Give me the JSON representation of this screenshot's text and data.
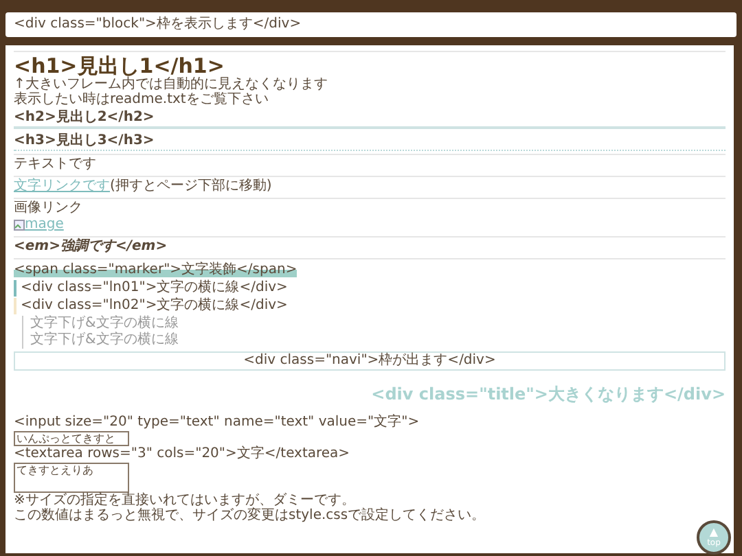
{
  "block": "<div class=\"block\">枠を表示します</div>",
  "h1": "<h1>見出し1</h1>",
  "h1_notes": [
    "↑大きいフレーム内では自動的に見えなくなります",
    "表示したい時はreadme.txtをご覧下さい"
  ],
  "h2": "<h2>見出し2</h2>",
  "h3": "<h3>見出し3</h3>",
  "text": "テキストです",
  "link": {
    "text": "文字リンクです",
    "note": "(押すとページ下部に移動)"
  },
  "image_link": {
    "label": "画像リンク",
    "alt": "mage"
  },
  "em": "<em>強調です</em>",
  "marker": "<span class=\"marker\">文字装飾</span>",
  "ln01": "<div class=\"ln01\">文字の横に線</div>",
  "ln02": "<div class=\"ln02\">文字の横に線</div>",
  "indent_lines": [
    "文字下げ&文字の横に線",
    "文字下げ&文字の横に線"
  ],
  "navi": "<div class=\"navi\">枠が出ます</div>",
  "title": "<div class=\"title\">大きくなります</div>",
  "input_label": "<input size=\"20\" type=\"text\" name=\"text\" value=\"文字\">",
  "input_value": "いんぷっとてきすと",
  "textarea_label": "<textarea rows=\"3\" cols=\"20\">文字</textarea>",
  "textarea_value": "てきすとえりあ",
  "notes": [
    "※サイズの指定を直接いれてはいますが、ダミーです。",
    "この数値はまるっと無視で、サイズの変更はstyle.cssで設定してください。"
  ],
  "top_button": {
    "icon": "▲",
    "label": "top"
  }
}
